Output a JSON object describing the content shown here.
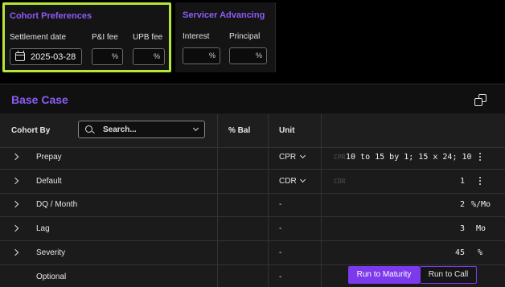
{
  "cohort_preferences": {
    "title": "Cohort Preferences",
    "settlement_date_label": "Settlement date",
    "settlement_date_value": "2025-03-28",
    "pi_fee_label": "P&I fee",
    "upb_fee_label": "UPB fee",
    "pct_symbol": "%"
  },
  "servicer_advancing": {
    "title": "Servicer Advancing",
    "interest_label": "Interest",
    "principal_label": "Principal",
    "pct_symbol": "%"
  },
  "base_case": {
    "title": "Base Case",
    "columns": {
      "cohort_by": "Cohort By",
      "search_placeholder": "Search...",
      "pct_bal": "% Bal",
      "unit": "Unit"
    },
    "rows": [
      {
        "name": "Prepay",
        "unit": "CPR",
        "unit_dropdown": true,
        "placeholder": "CPR",
        "value": "10 to 15 by 1; 15 x 24; 10",
        "suffix": "",
        "menu": true,
        "expandable": true
      },
      {
        "name": "Default",
        "unit": "CDR",
        "unit_dropdown": true,
        "placeholder": "CDR",
        "value": "1",
        "suffix": "",
        "menu": true,
        "expandable": true
      },
      {
        "name": "DQ / Month",
        "unit": "-",
        "unit_dropdown": false,
        "placeholder": "",
        "value": "2",
        "suffix": "%/Mo",
        "menu": false,
        "expandable": true
      },
      {
        "name": "Lag",
        "unit": "-",
        "unit_dropdown": false,
        "placeholder": "",
        "value": "3",
        "suffix": "Mo",
        "menu": false,
        "expandable": true
      },
      {
        "name": "Severity",
        "unit": "-",
        "unit_dropdown": false,
        "placeholder": "",
        "value": "45",
        "suffix": "%",
        "menu": false,
        "expandable": true
      },
      {
        "name": "Optional",
        "unit": "-",
        "unit_dropdown": false,
        "placeholder": "",
        "value": "",
        "suffix": "",
        "menu": false,
        "expandable": false
      }
    ],
    "optional_buttons": {
      "run_to_maturity": "Run to Maturity",
      "run_to_call": "Run to Call"
    }
  },
  "colors": {
    "accent_purple": "#8b5cf6",
    "highlight_green": "#b6e63a",
    "button_active": "#7c3aed"
  }
}
